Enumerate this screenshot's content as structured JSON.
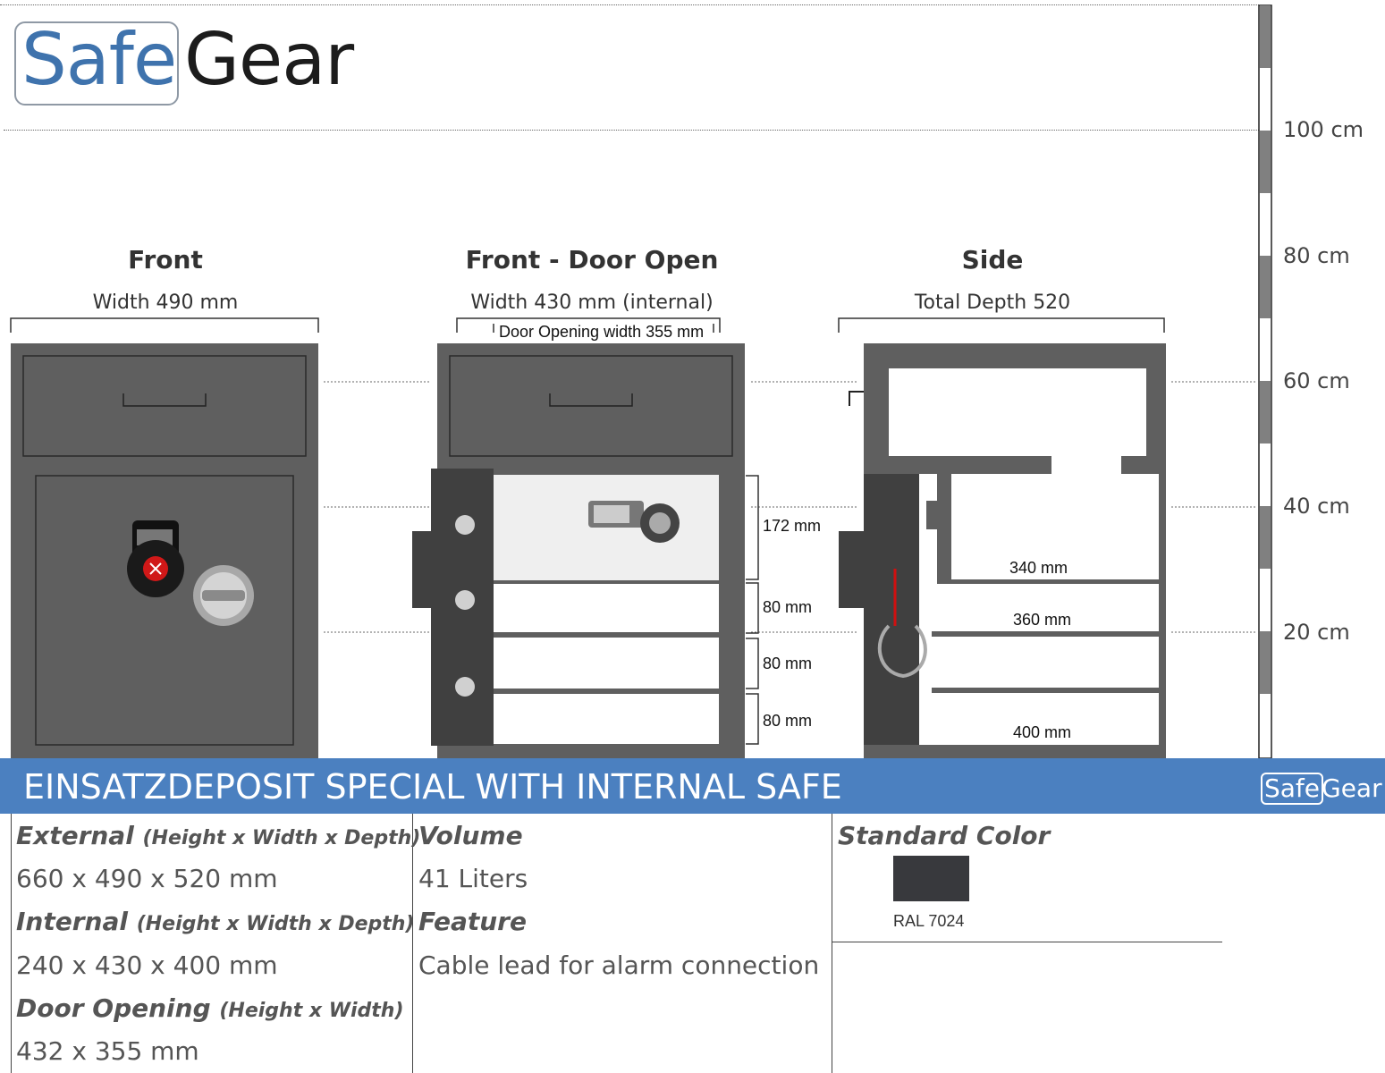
{
  "brand": {
    "safe": "Safe",
    "gear": "Gear"
  },
  "views": [
    {
      "title": "Front",
      "subtitle": "Width 490 mm"
    },
    {
      "title": "Front - Door Open",
      "subtitle": "Width 430 mm (internal)",
      "inner_note": "Door Opening width 355 mm"
    },
    {
      "title": "Side",
      "subtitle": "Total Depth 520"
    }
  ],
  "front_open_dims": [
    "172 mm",
    "80 mm",
    "80 mm",
    "80 mm"
  ],
  "side_dims": [
    "340 mm",
    "360 mm",
    "400 mm"
  ],
  "scale": [
    "100 cm",
    "80 cm",
    "60 cm",
    "40 cm",
    "20 cm"
  ],
  "banner": {
    "title": "EINSATZDEPOSIT SPECIAL WITH INTERNAL SAFE",
    "logo_safe": "Safe",
    "logo_gear": "Gear"
  },
  "specs": {
    "external_label": "External",
    "external_note": "(Height x Width x Depth)",
    "external_value": "660 x 490 x 520 mm",
    "internal_label": "Internal",
    "internal_note": "(Height x Width x Depth)",
    "internal_value": "240 x 430 x 400 mm",
    "door_label": "Door Opening",
    "door_note": "(Height x Width)",
    "door_value": "432 x 355 mm",
    "volume_label": "Volume",
    "volume_value": "41 Liters",
    "feature_label": "Feature",
    "feature_value": "Cable lead for alarm connection",
    "color_label": "Standard Color",
    "color_name": "RAL 7024",
    "color_hex": "#38393d"
  },
  "colors": {
    "body": "#5f5f5f",
    "dark": "#404040",
    "banner": "#4b80c0"
  }
}
